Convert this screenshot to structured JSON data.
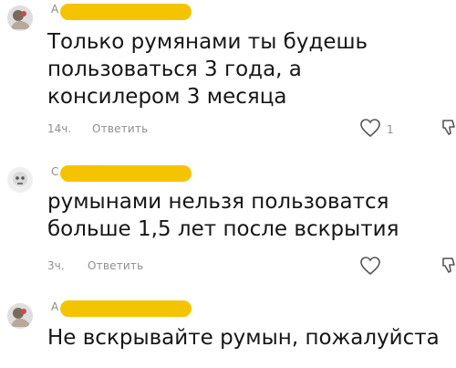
{
  "comments": [
    {
      "user_initial": "А",
      "text_lines": [
        "Только румянами ты будешь",
        "пользоваться 3 года, а",
        "консилером 3 месяца"
      ],
      "time": "14ч.",
      "reply_label": "Ответить",
      "likes": "1",
      "like_icon": "heart-outline-icon",
      "dislike_icon": "thumb-down-icon"
    },
    {
      "user_initial": "С",
      "text_lines": [
        "румынами нельзя пользоватся",
        "больше 1,5 лет после вскрытия"
      ],
      "time": "3ч.",
      "reply_label": "Ответить",
      "likes": "",
      "like_icon": "heart-outline-icon",
      "dislike_icon": "thumb-down-icon"
    },
    {
      "user_initial": "А",
      "text_lines": [
        "Не вскрывайте румын, пожалуйста"
      ],
      "time": "",
      "reply_label": "",
      "likes": "",
      "like_icon": "",
      "dislike_icon": ""
    }
  ],
  "colors": {
    "username_mask": "#f5c400",
    "meta_text": "#8f8f8f",
    "body_text": "#161616"
  }
}
